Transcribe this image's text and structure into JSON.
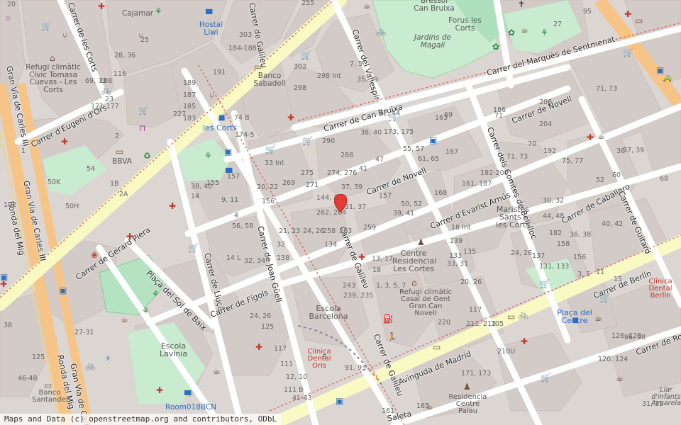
{
  "attribution": "Maps and Data (c) openstreetmap.org and contributors, ODbL",
  "marker": {
    "name": "map-pin"
  },
  "colors": {
    "land": "#dcd6d3",
    "block": "#d3cbc7",
    "park": "#c9ebd0",
    "primary_road": "#f7f8c1",
    "trunk_road": "#f9c98f",
    "pin": "#e53935"
  },
  "streets": [
    "Carrer de Galileu",
    "Carrer del Vallespir",
    "Carrer del Marquès de Sentmenat",
    "Carrer de Can Bruixa",
    "Carrer de Novell",
    "Carrer d'Evarist Arnús",
    "Carrer dels Comtes de Bell·lloc",
    "Carrer de Caballero",
    "Carrer de Guitard",
    "Carrer de Berlín",
    "Avinguda de Madrid",
    "Carrer de Robrenyo",
    "Carrer de Joan Güell",
    "Carrer de Lluçà",
    "Carrer de Fígols",
    "Plaça del Sol de Baix",
    "Carrer de Gerard Piera",
    "Carrer d'Eugeni d'Ors",
    "Carrer de les Corts",
    "Gran Via de Carles III",
    "Ronda del Mig",
    "Carrer de Galileu",
    "Saleta"
  ],
  "places": [
    {
      "name": "Bressol Can Bruixa"
    },
    {
      "name": "Forus les Corts"
    },
    {
      "name": "Jardins de Magalí"
    },
    {
      "name": "Hostal Liwi"
    },
    {
      "name": "Banco Sabadell"
    },
    {
      "name": "Refugi climàtic Cívic Tomasa Cuevas - Les Corts"
    },
    {
      "name": "les Corts"
    },
    {
      "name": "BBVA"
    },
    {
      "name": "Cajamar"
    },
    {
      "name": "Maristes Sants - les Corts"
    },
    {
      "name": "Centre Residencial Les Cortes"
    },
    {
      "name": "Refugi climàtic Casal de Gent Gran Can Novell"
    },
    {
      "name": "Escola Barcelona"
    },
    {
      "name": "Clínica Dental Oris"
    },
    {
      "name": "Plaça del Centre"
    },
    {
      "name": "Clínica Dental Berlín"
    },
    {
      "name": "Escola Lavinia"
    },
    {
      "name": "Banco Santander"
    },
    {
      "name": "Room018BCN"
    },
    {
      "name": "Residencia Centre Palau"
    },
    {
      "name": "Llar d'infants Acuarela"
    }
  ],
  "house_numbers": [
    "255",
    "303",
    "184-188",
    "191",
    "189",
    "187",
    "185",
    "183",
    "227",
    "74 B",
    "174-5",
    "302",
    "298 Int",
    "298",
    "35, 39",
    "7, 5",
    "42, 44",
    "38, 40",
    "173, 175",
    "290",
    "288",
    "274, 276",
    "275",
    "271",
    "269",
    "33 Int",
    "20, 22",
    "156",
    "144, 148",
    "37, 39",
    "41",
    "47",
    "55, 57",
    "61, 65",
    "167",
    "163",
    "69",
    "71",
    "186",
    "206",
    "204",
    "75, 77",
    "71, 73",
    "70",
    "192",
    "192-200",
    "161, 187",
    "168",
    "157",
    "50, 52",
    "39, 41",
    "31, 37",
    "262, 264",
    "263",
    "258",
    "259",
    "21, 23",
    "24, 26",
    "32",
    "138",
    "134",
    "13, 17",
    "18",
    "18 Int",
    "139",
    "135",
    "133",
    "33, 31",
    "24, 26",
    "30, 32",
    "36, 38",
    "40, 42",
    "44, 48",
    "182",
    "158",
    "156",
    "137",
    "131, 133",
    "3, 5",
    "243",
    "239, 235",
    "1, 3, 5, 7",
    "20, 26",
    "117",
    "211, 213",
    "105",
    "220",
    "210U",
    "171, 173",
    "161",
    "165",
    "157",
    "155",
    "9, 11",
    "4",
    "56, 58",
    "38, 40",
    "14",
    "14 L",
    "32, 34",
    "24, 26",
    "125",
    "117",
    "111",
    "12, 10",
    "111 B",
    "41-43",
    "38",
    "27-31",
    "46-48",
    "50H",
    "50K",
    "54",
    "1",
    "2",
    "1B",
    "2A",
    "28, 36",
    "69, 73",
    "71, 73",
    "36",
    "37, 39",
    "60",
    "68",
    "52",
    "126, 128",
    "120, 124",
    "96, 98",
    "31, 35",
    "11",
    "15",
    "20",
    "23",
    "25",
    "171-177",
    "5",
    "91, 93",
    "95",
    "27",
    "125",
    "102",
    "108",
    "116"
  ]
}
